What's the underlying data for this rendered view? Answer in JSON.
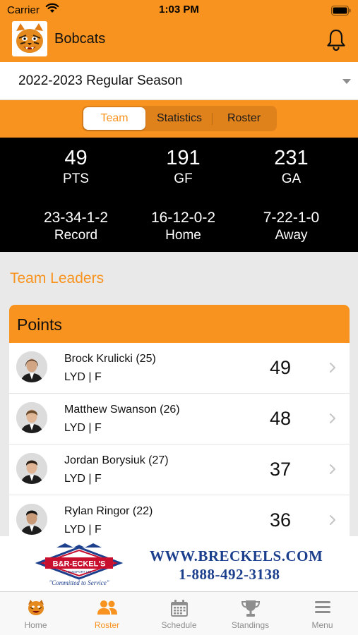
{
  "status_bar": {
    "carrier": "Carrier",
    "time": "1:03 PM"
  },
  "header": {
    "team_name": "Bobcats"
  },
  "season": {
    "selected": "2022-2023 Regular Season"
  },
  "tabs": [
    {
      "label": "Team",
      "active": true
    },
    {
      "label": "Statistics",
      "active": false
    },
    {
      "label": "Roster",
      "active": false
    }
  ],
  "team_stats": {
    "pts": {
      "value": "49",
      "label": "PTS"
    },
    "gf": {
      "value": "191",
      "label": "GF"
    },
    "ga": {
      "value": "231",
      "label": "GA"
    },
    "record": {
      "value": "23-34-1-2",
      "label": "Record"
    },
    "home": {
      "value": "16-12-0-2",
      "label": "Home"
    },
    "away": {
      "value": "7-22-1-0",
      "label": "Away"
    }
  },
  "leaders": {
    "title": "Team Leaders",
    "card_title": "Points",
    "players": [
      {
        "name": "Brock Krulicki (25)",
        "team_pos": "LYD | F",
        "value": "49"
      },
      {
        "name": "Matthew Swanson (26)",
        "team_pos": "LYD | F",
        "value": "48"
      },
      {
        "name": "Jordan Borysiuk (27)",
        "team_pos": "LYD | F",
        "value": "37"
      },
      {
        "name": "Rylan Ringor (22)",
        "team_pos": "LYD | F",
        "value": "36"
      }
    ]
  },
  "ad": {
    "brand_top": "B&R-ECKEL'S",
    "brand_sub": "TRANSPORT LTD.",
    "slogan": "\"Committed to Service\"",
    "url": "WWW.BRECKELS.COM",
    "phone": "1-888-492-3138"
  },
  "tab_bar": [
    {
      "label": "Home",
      "icon": "team-logo-icon",
      "active": false
    },
    {
      "label": "Roster",
      "icon": "people-icon",
      "active": true
    },
    {
      "label": "Schedule",
      "icon": "calendar-icon",
      "active": false
    },
    {
      "label": "Standings",
      "icon": "trophy-icon",
      "active": false
    },
    {
      "label": "Menu",
      "icon": "hamburger-icon",
      "active": false
    }
  ],
  "colors": {
    "accent": "#f7931e",
    "stats_bg": "#000000",
    "ad_blue": "#1b3f8c",
    "ad_red": "#c8102e"
  }
}
